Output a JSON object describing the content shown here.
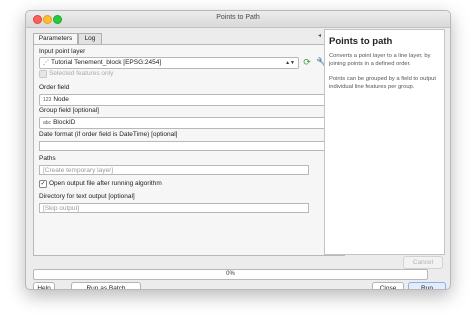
{
  "window": {
    "title": "Points to Path"
  },
  "tabs": [
    {
      "label": "Parameters",
      "active": true
    },
    {
      "label": "Log",
      "active": false
    }
  ],
  "params": {
    "input_layer": {
      "label": "Input point layer",
      "value": "Tutorial Tenement_block [EPSG:2454]",
      "icon": "point-layer-icon"
    },
    "selected_only": {
      "label": "Selected features only",
      "checked": false,
      "enabled": false
    },
    "order_field": {
      "label": "Order field",
      "type_prefix": "123",
      "value": "Node"
    },
    "group_field": {
      "label": "Group field [optional]",
      "type_prefix": "abc",
      "value": "BlockID"
    },
    "date_format": {
      "label": "Date format (if order field is DateTime) [optional]",
      "value": ""
    },
    "paths": {
      "label": "Paths",
      "placeholder": "[Create temporary layer]"
    },
    "open_output": {
      "label": "Open output file after running algorithm",
      "checked": true
    },
    "directory": {
      "label": "Directory for text output [optional]",
      "placeholder": "[Skip output]"
    },
    "browse_label": "..."
  },
  "help": {
    "title": "Points to path",
    "paragraph1": "Converts a point layer to a line layer, by joining points in a defined order.",
    "paragraph2": "Points can be grouped by a field to output individual line features per group."
  },
  "progress": {
    "value": 0,
    "text": "0%"
  },
  "buttons": {
    "cancel": "Cancel",
    "help": "Help",
    "batch": "Run as Batch Process...",
    "close": "Close",
    "run": "Run"
  },
  "colors": {
    "accent": "#3b85e0",
    "close": "#fe5f57",
    "minimize": "#febc2e",
    "maximize": "#28c840"
  }
}
